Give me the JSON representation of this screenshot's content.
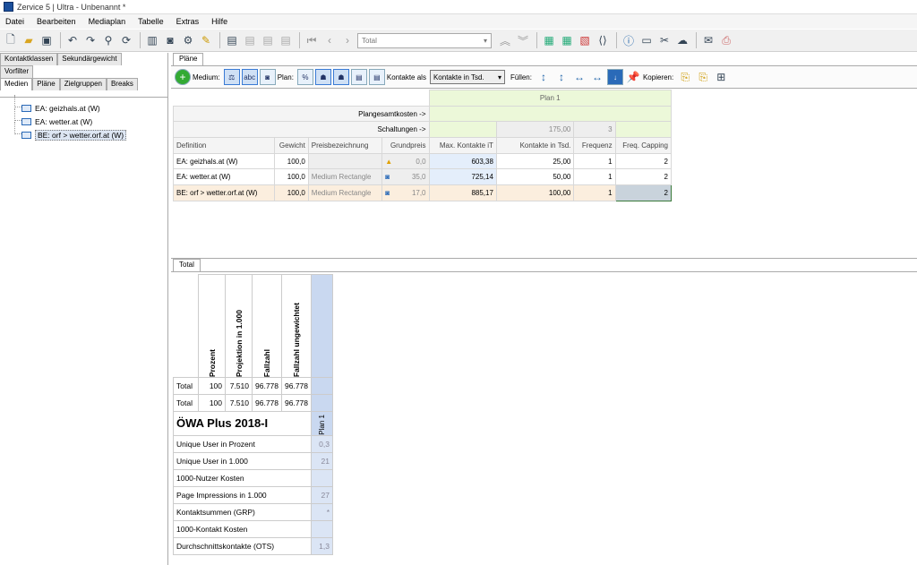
{
  "window": {
    "title": "Zervice 5 | Ultra - Unbenannt *"
  },
  "menu": [
    "Datei",
    "Bearbeiten",
    "Mediaplan",
    "Tabelle",
    "Extras",
    "Hilfe"
  ],
  "toolbar": {
    "select_value": "Total"
  },
  "left": {
    "tabs_row1": [
      "Kontaktklassen",
      "Sekundärgewicht"
    ],
    "tabs_row2": [
      "Vorfilter"
    ],
    "tabs_row3": [
      "Medien",
      "Pläne",
      "Zielgruppen",
      "Breaks"
    ],
    "tree": [
      "EA: geizhals.at (W)",
      "EA: wetter.at (W)",
      "BE: orf > wetter.orf.at (W)"
    ]
  },
  "plans_tab": "Pläne",
  "ptoolbar": {
    "medium": "Medium:",
    "plan": "Plan:",
    "kontakte_als": "Kontakte als",
    "kontakte_value": "Kontakte in Tsd.",
    "fuellen": "Füllen:",
    "kopieren": "Kopieren:"
  },
  "grid": {
    "plan_header": "Plan 1",
    "plangesamtkosten": "Plangesamtkosten ->",
    "schaltungen": "Schaltungen ->",
    "schaltungen_kontakte": "175,00",
    "schaltungen_freq": "3",
    "headers": [
      "Definition",
      "Gewicht",
      "Preisbezeichnung",
      "Grundpreis",
      "Max. Kontakte iT",
      "Kontakte in Tsd.",
      "Frequenz",
      "Freq. Capping"
    ],
    "rows": [
      {
        "def": "EA: geizhals.at (W)",
        "gewicht": "100,0",
        "preis": "",
        "grundpreis": "0,0",
        "max": "603,38",
        "kontakte": "25,00",
        "freq": "1",
        "cap": "2"
      },
      {
        "def": "EA: wetter.at (W)",
        "gewicht": "100,0",
        "preis": "Medium Rectangle",
        "grundpreis": "35,0",
        "max": "725,14",
        "kontakte": "50,00",
        "freq": "1",
        "cap": "2"
      },
      {
        "def": "BE: orf > wetter.orf.at (W)",
        "gewicht": "100,0",
        "preis": "Medium Rectangle",
        "grundpreis": "17,0",
        "max": "885,17",
        "kontakte": "100,00",
        "freq": "1",
        "cap": "2"
      }
    ]
  },
  "total": {
    "tab": "Total",
    "col_headers": [
      "Prozent",
      "Projektion in 1.000",
      "Fallzahl",
      "Fallzahl ungewichtet"
    ],
    "plan_label": "Plan 1",
    "rows": [
      {
        "label": "Total",
        "v": [
          "100",
          "7.510",
          "96.778",
          "96.778"
        ]
      },
      {
        "label": "Total",
        "v": [
          "100",
          "7.510",
          "96.778",
          "96.778"
        ]
      }
    ],
    "owa": "ÖWA Plus 2018-I",
    "metrics": [
      {
        "label": "Unique User in Prozent",
        "val": "0,3"
      },
      {
        "label": "Unique User in 1.000",
        "val": "21"
      },
      {
        "label": "1000-Nutzer Kosten",
        "val": ""
      },
      {
        "label": "Page Impressions in 1.000",
        "val": "27"
      },
      {
        "label": "Kontaktsummen (GRP)",
        "val": "*"
      },
      {
        "label": "1000-Kontakt Kosten",
        "val": ""
      },
      {
        "label": "Durchschnittskontakte (OTS)",
        "val": "1,3"
      }
    ]
  }
}
